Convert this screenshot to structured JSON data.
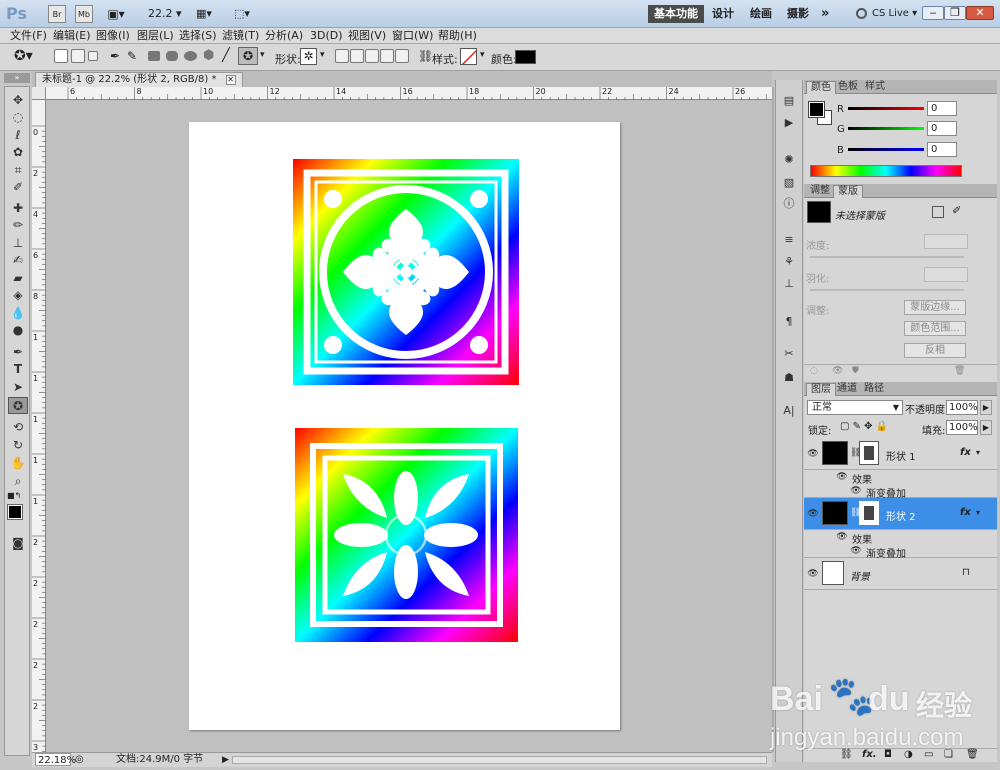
{
  "app": {
    "logo": "Ps",
    "zoom_value": "22.2",
    "workspaces": [
      "基本功能",
      "设计",
      "绘画",
      "摄影"
    ],
    "more": "»",
    "cs_live": "CS Live"
  },
  "menus": [
    "文件(F)",
    "编辑(E)",
    "图像(I)",
    "图层(L)",
    "选择(S)",
    "滤镜(T)",
    "分析(A)",
    "3D(D)",
    "视图(V)",
    "窗口(W)",
    "帮助(H)"
  ],
  "options": {
    "shape_label": "形状:",
    "style_label": "样式:",
    "color_label": "颜色:"
  },
  "document": {
    "tab_title": "未标题-1 @ 22.2% (形状 2, RGB/8) *",
    "zoom": "22.18%",
    "doc_info": "文档:24.9M/0 字节"
  },
  "ruler": {
    "top": [
      "6",
      "8",
      "10",
      "12",
      "14",
      "16",
      "18",
      "20",
      "22",
      "24",
      "26"
    ],
    "left": [
      "0",
      "2",
      "4",
      "6",
      "8",
      "1",
      "1",
      "1",
      "1",
      "1",
      "2",
      "2",
      "2",
      "2",
      "2",
      "3"
    ]
  },
  "color_panel": {
    "tabs": [
      "颜色",
      "色板",
      "样式"
    ],
    "r_label": "R",
    "g_label": "G",
    "b_label": "B",
    "r_value": "0",
    "g_value": "0",
    "b_value": "0"
  },
  "masks_panel": {
    "tabs": [
      "调整",
      "蒙版"
    ],
    "title": "未选择蒙版",
    "density_label": "浓度:",
    "feather_label": "羽化:",
    "refine_label": "调整:",
    "btn_mask_edge": "蒙版边缘...",
    "btn_color_range": "颜色范围...",
    "btn_invert": "反相"
  },
  "layers_panel": {
    "tabs": [
      "图层",
      "通道",
      "路径"
    ],
    "blend_mode": "正常",
    "opacity_label": "不透明度:",
    "opacity_value": "100%",
    "lock_label": "锁定:",
    "fill_label": "填充:",
    "fill_value": "100%",
    "layers": [
      {
        "name": "形状 1",
        "effects_label": "效果",
        "effect_name": "渐变叠加"
      },
      {
        "name": "形状 2",
        "effects_label": "效果",
        "effect_name": "渐变叠加"
      },
      {
        "name": "背景"
      }
    ]
  },
  "watermark": {
    "brand": "Bai",
    "brand2": "du",
    "cn": "经验",
    "url": "jingyan.baidu.com"
  },
  "colors": {
    "selected_layer": "#3c8ee6",
    "accent": "#4a4a4a"
  }
}
